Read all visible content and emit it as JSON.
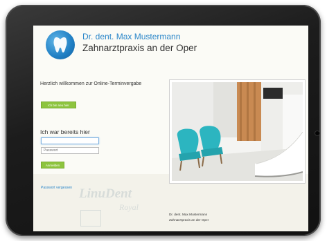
{
  "header": {
    "practice_name": "Dr. dent. Max Mustermann",
    "practice_subtitle": "Zahnarztpraxis an der Oper"
  },
  "main": {
    "welcome_text": "Herzlich willkommen zur Online-Terminvergabe",
    "new_patient_button": "Ich bin neu hier",
    "returning_heading": "Ich war bereits hier",
    "username_value": "",
    "password_placeholder": "Passwort",
    "login_button": "Anmelden",
    "forgot_password_link": "Passwort vergessen"
  },
  "watermark": {
    "line1": "LinuDent",
    "line2": "Royal"
  },
  "footer": {
    "line1": "Dr. dent. Max Mustermann",
    "line2": "Zahnarztpraxis an der Oper"
  },
  "colors": {
    "accent_blue": "#2a86c9",
    "button_green": "#8dc43e",
    "chair_teal": "#2cb5c0"
  },
  "icons": {
    "logo": "tooth-logo-icon",
    "photo": "waiting-room-photo"
  }
}
